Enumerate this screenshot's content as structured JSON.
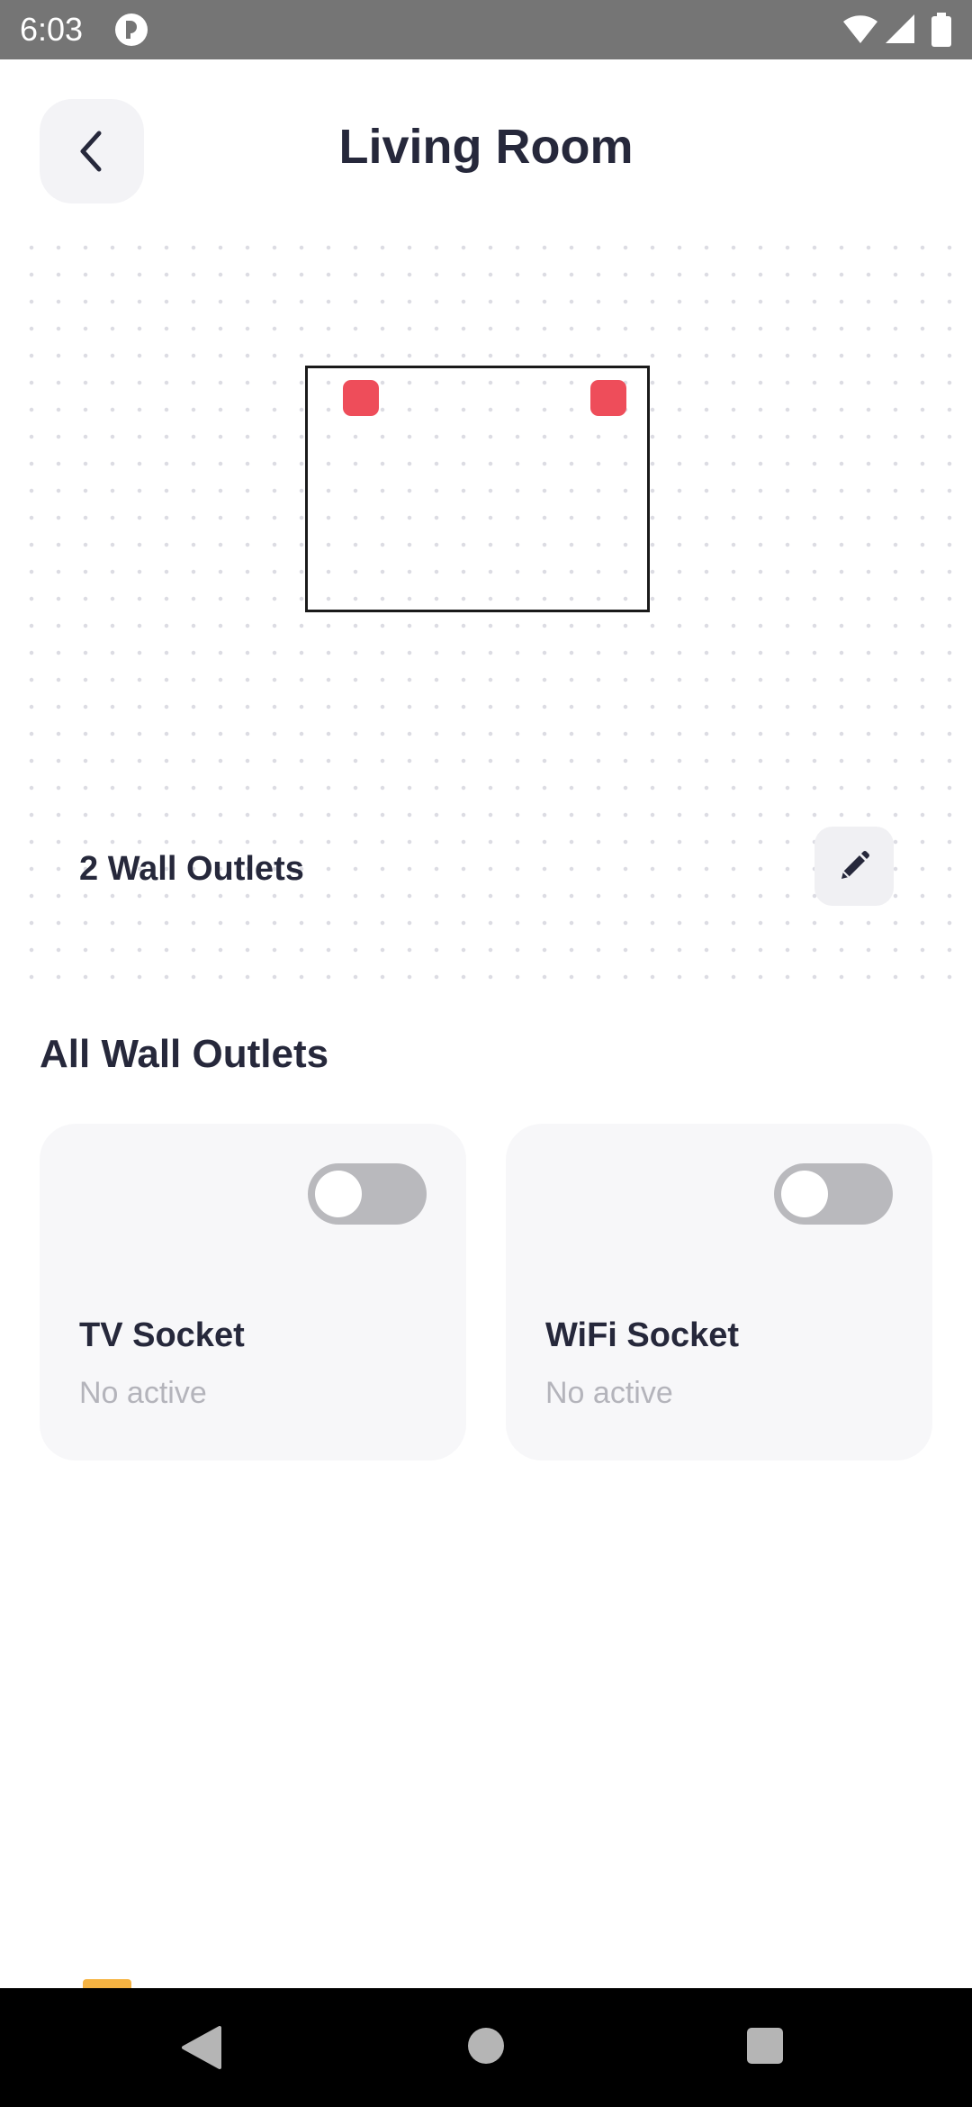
{
  "status_bar": {
    "time": "6:03"
  },
  "header": {
    "title": "Living Room",
    "back_icon": "chevron-left-icon"
  },
  "floorplan": {
    "outlets_count_label": "2 Wall Outlets",
    "edit_icon": "pencil-icon",
    "outlet_color": "#ee4d5a"
  },
  "section": {
    "title": "All Wall Outlets"
  },
  "outlets": [
    {
      "name": "TV Socket",
      "status": "No active",
      "enabled": false
    },
    {
      "name": "WiFi Socket",
      "status": "No active",
      "enabled": false
    }
  ],
  "colors": {
    "accent_red": "#ee4d5a",
    "toggle_off": "#b9b9bd",
    "card_bg": "#f7f7f9"
  }
}
